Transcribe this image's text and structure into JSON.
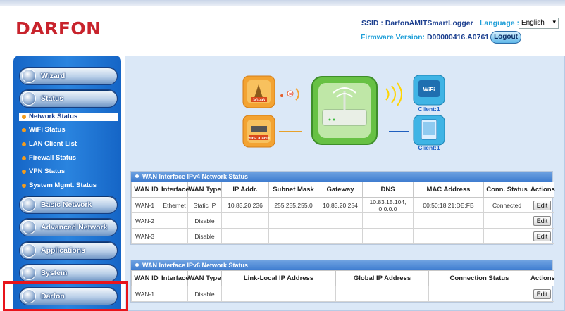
{
  "brand": {
    "logo": "DARFON"
  },
  "header": {
    "ssid_label": "SSID :",
    "ssid_value": "DarfonAMITSmartLogger",
    "firmware_label": "Firmware Version:",
    "firmware_value": "D00000416.A0761",
    "language_label": "Language :",
    "language_value": "English",
    "logout_label": "Logout"
  },
  "sidebar": {
    "wizard": "Wizard",
    "status": "Status",
    "sub": [
      "Network Status",
      "WiFi Status",
      "LAN Client List",
      "Firewall Status",
      "VPN Status",
      "System Mgmt. Status"
    ],
    "basic_network": "Basic Network",
    "advanced_network": "Advanced Network",
    "applications": "Applications",
    "system": "System",
    "darfon": "Darfon"
  },
  "diagram": {
    "modem_3g_label": "3G/4G",
    "xdsl_label": "xDSL/Cable",
    "wifi_label": "WiFi",
    "client_wifi": "Client:1",
    "client_lan": "Client:1"
  },
  "ipv4": {
    "title": "WAN Interface IPv4 Network Status",
    "headers": [
      "WAN ID",
      "Interface",
      "WAN Type",
      "IP Addr.",
      "Subnet Mask",
      "Gateway",
      "DNS",
      "MAC Address",
      "Conn. Status",
      "Actions"
    ],
    "rows": [
      {
        "id": "WAN-1",
        "iface": "Ethernet",
        "type": "Static IP",
        "ip": "10.83.20.236",
        "mask": "255.255.255.0",
        "gw": "10.83.20.254",
        "dns1": "10.83.15.104,",
        "dns2": "0.0.0.0",
        "mac": "00:50:18:21:DE:FB",
        "status": "Connected",
        "action": "Edit"
      },
      {
        "id": "WAN-2",
        "iface": "",
        "type": "Disable",
        "ip": "",
        "mask": "",
        "gw": "",
        "dns1": "",
        "dns2": "",
        "mac": "",
        "status": "",
        "action": "Edit"
      },
      {
        "id": "WAN-3",
        "iface": "",
        "type": "Disable",
        "ip": "",
        "mask": "",
        "gw": "",
        "dns1": "",
        "dns2": "",
        "mac": "",
        "status": "",
        "action": "Edit"
      }
    ]
  },
  "ipv6": {
    "title": "WAN Interface IPv6 Network Status",
    "headers": [
      "WAN ID",
      "Interface",
      "WAN Type",
      "Link-Local IP Address",
      "Global IP Address",
      "Connection Status",
      "Actions"
    ],
    "rows": [
      {
        "id": "WAN-1",
        "iface": "",
        "type": "Disable",
        "link": "",
        "global": "",
        "status": "",
        "action": "Edit"
      }
    ]
  },
  "colors": {
    "brand_red": "#c8232c",
    "sidebar_blue": "#1e6fd0",
    "header_blue": "#1f9fd8",
    "highlight": "#e8141b"
  }
}
